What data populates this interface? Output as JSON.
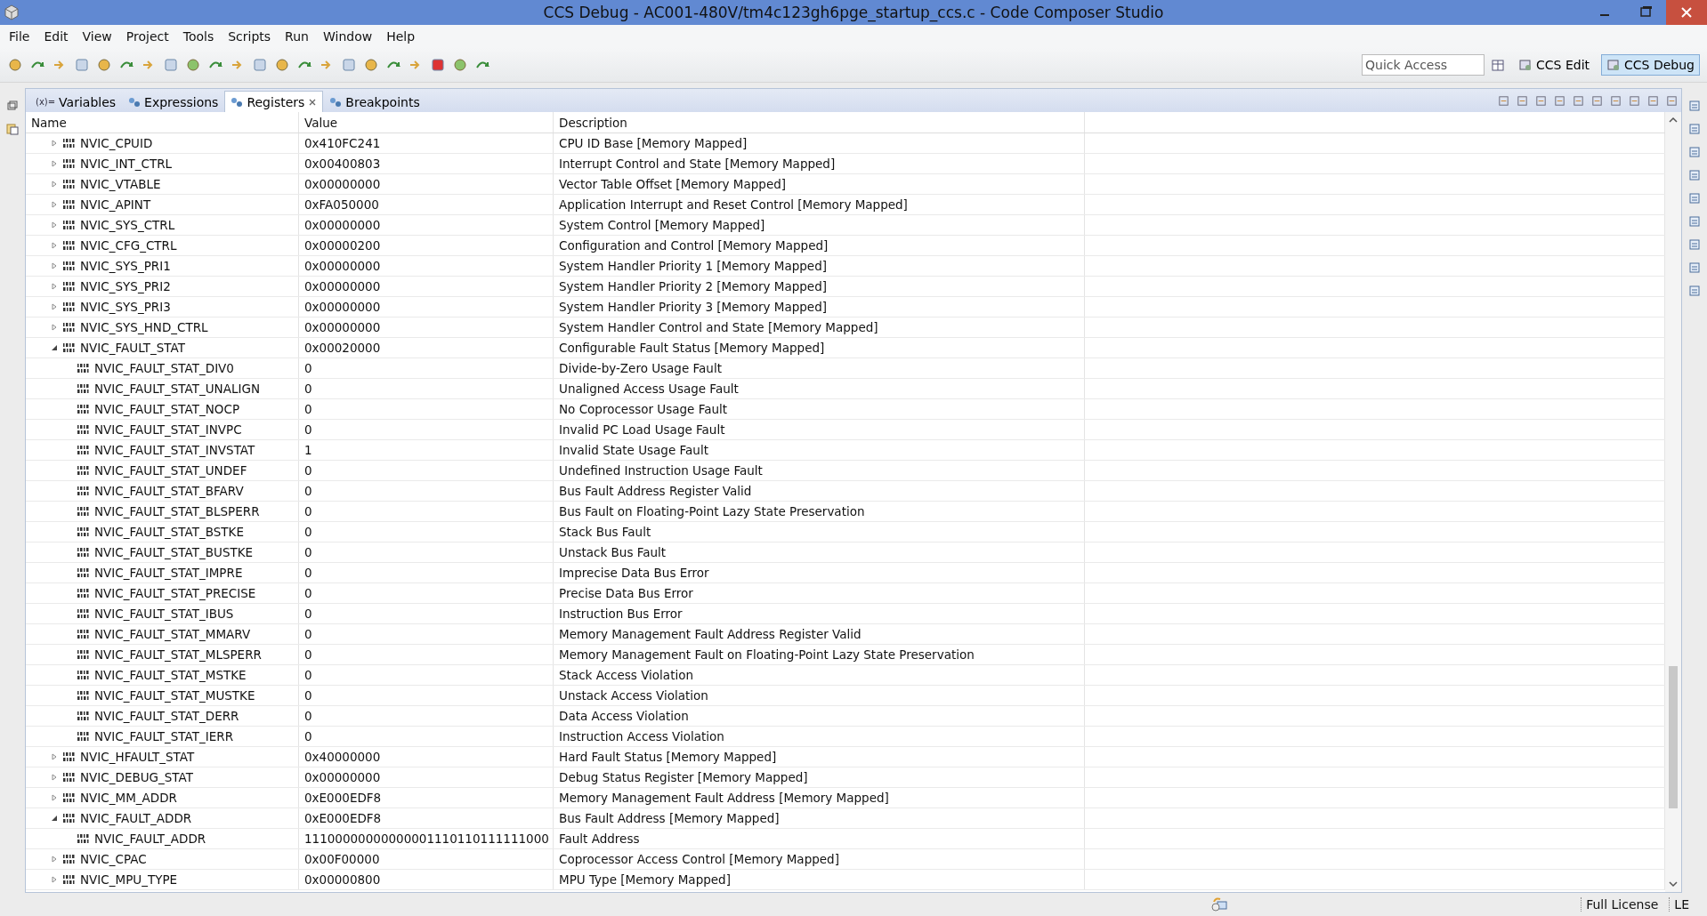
{
  "window": {
    "title": "CCS Debug - AC001-480V/tm4c123gh6pge_startup_ccs.c - Code Composer Studio"
  },
  "menu": [
    "File",
    "Edit",
    "View",
    "Project",
    "Tools",
    "Scripts",
    "Run",
    "Window",
    "Help"
  ],
  "quick_access": {
    "placeholder": "Quick Access"
  },
  "perspectives": [
    {
      "label": "CCS Edit",
      "selected": false
    },
    {
      "label": "CCS Debug",
      "selected": true
    }
  ],
  "tabs": [
    {
      "label": "Variables",
      "icon": "(x)=",
      "selected": false
    },
    {
      "label": "Expressions",
      "selected": false
    },
    {
      "label": "Registers",
      "selected": true
    },
    {
      "label": "Breakpoints",
      "selected": false
    }
  ],
  "table": {
    "columns": [
      "Name",
      "Value",
      "Description"
    ],
    "rows": [
      {
        "name": "NVIC_CPUID",
        "value": "0x410FC241",
        "description": "CPU ID Base [Memory Mapped]",
        "expanded": false
      },
      {
        "name": "NVIC_INT_CTRL",
        "value": "0x00400803",
        "description": "Interrupt Control and State [Memory Mapped]",
        "expanded": false
      },
      {
        "name": "NVIC_VTABLE",
        "value": "0x00000000",
        "description": "Vector Table Offset [Memory Mapped]",
        "expanded": false
      },
      {
        "name": "NVIC_APINT",
        "value": "0xFA050000",
        "description": "Application Interrupt and Reset Control [Memory Mapped]",
        "expanded": false
      },
      {
        "name": "NVIC_SYS_CTRL",
        "value": "0x00000000",
        "description": "System Control [Memory Mapped]",
        "expanded": false
      },
      {
        "name": "NVIC_CFG_CTRL",
        "value": "0x00000200",
        "description": "Configuration and Control [Memory Mapped]",
        "expanded": false
      },
      {
        "name": "NVIC_SYS_PRI1",
        "value": "0x00000000",
        "description": "System Handler Priority 1 [Memory Mapped]",
        "expanded": false
      },
      {
        "name": "NVIC_SYS_PRI2",
        "value": "0x00000000",
        "description": "System Handler Priority 2 [Memory Mapped]",
        "expanded": false
      },
      {
        "name": "NVIC_SYS_PRI3",
        "value": "0x00000000",
        "description": "System Handler Priority 3 [Memory Mapped]",
        "expanded": false
      },
      {
        "name": "NVIC_SYS_HND_CTRL",
        "value": "0x00000000",
        "description": "System Handler Control and State [Memory Mapped]",
        "expanded": false
      },
      {
        "name": "NVIC_FAULT_STAT",
        "value": "0x00020000",
        "description": "Configurable Fault Status [Memory Mapped]",
        "expanded": true,
        "children": [
          {
            "name": "NVIC_FAULT_STAT_DIV0",
            "value": "0",
            "description": "Divide-by-Zero Usage Fault"
          },
          {
            "name": "NVIC_FAULT_STAT_UNALIGN",
            "value": "0",
            "description": "Unaligned Access Usage Fault"
          },
          {
            "name": "NVIC_FAULT_STAT_NOCP",
            "value": "0",
            "description": "No Coprocessor Usage Fault"
          },
          {
            "name": "NVIC_FAULT_STAT_INVPC",
            "value": "0",
            "description": "Invalid PC Load Usage Fault"
          },
          {
            "name": "NVIC_FAULT_STAT_INVSTAT",
            "value": "1",
            "description": "Invalid State Usage Fault"
          },
          {
            "name": "NVIC_FAULT_STAT_UNDEF",
            "value": "0",
            "description": "Undefined Instruction Usage Fault"
          },
          {
            "name": "NVIC_FAULT_STAT_BFARV",
            "value": "0",
            "description": "Bus Fault Address Register Valid"
          },
          {
            "name": "NVIC_FAULT_STAT_BLSPERR",
            "value": "0",
            "description": "Bus Fault on Floating-Point Lazy State Preservation"
          },
          {
            "name": "NVIC_FAULT_STAT_BSTKE",
            "value": "0",
            "description": "Stack Bus Fault"
          },
          {
            "name": "NVIC_FAULT_STAT_BUSTKE",
            "value": "0",
            "description": "Unstack Bus Fault"
          },
          {
            "name": "NVIC_FAULT_STAT_IMPRE",
            "value": "0",
            "description": "Imprecise Data Bus Error"
          },
          {
            "name": "NVIC_FAULT_STAT_PRECISE",
            "value": "0",
            "description": "Precise Data Bus Error"
          },
          {
            "name": "NVIC_FAULT_STAT_IBUS",
            "value": "0",
            "description": "Instruction Bus Error"
          },
          {
            "name": "NVIC_FAULT_STAT_MMARV",
            "value": "0",
            "description": "Memory Management Fault Address Register Valid"
          },
          {
            "name": "NVIC_FAULT_STAT_MLSPERR",
            "value": "0",
            "description": "Memory Management Fault on Floating-Point Lazy State Preservation"
          },
          {
            "name": "NVIC_FAULT_STAT_MSTKE",
            "value": "0",
            "description": "Stack Access Violation"
          },
          {
            "name": "NVIC_FAULT_STAT_MUSTKE",
            "value": "0",
            "description": "Unstack Access Violation"
          },
          {
            "name": "NVIC_FAULT_STAT_DERR",
            "value": "0",
            "description": "Data Access Violation"
          },
          {
            "name": "NVIC_FAULT_STAT_IERR",
            "value": "0",
            "description": "Instruction Access Violation"
          }
        ]
      },
      {
        "name": "NVIC_HFAULT_STAT",
        "value": "0x40000000",
        "description": "Hard Fault Status [Memory Mapped]",
        "expanded": false
      },
      {
        "name": "NVIC_DEBUG_STAT",
        "value": "0x00000000",
        "description": "Debug Status Register [Memory Mapped]",
        "expanded": false
      },
      {
        "name": "NVIC_MM_ADDR",
        "value": "0xE000EDF8",
        "description": "Memory Management Fault Address [Memory Mapped]",
        "expanded": false
      },
      {
        "name": "NVIC_FAULT_ADDR",
        "value": "0xE000EDF8",
        "description": "Bus Fault Address [Memory Mapped]",
        "expanded": true,
        "children": [
          {
            "name": "NVIC_FAULT_ADDR",
            "value": "11100000000000001110110111111000",
            "description": "Fault Address"
          }
        ]
      },
      {
        "name": "NVIC_CPAC",
        "value": "0x00F00000",
        "description": "Coprocessor Access Control [Memory Mapped]",
        "expanded": false
      },
      {
        "name": "NVIC_MPU_TYPE",
        "value": "0x00000800",
        "description": "MPU Type [Memory Mapped]",
        "expanded": false
      }
    ]
  },
  "status_bar": {
    "license": "Full License",
    "edition": "LE"
  }
}
